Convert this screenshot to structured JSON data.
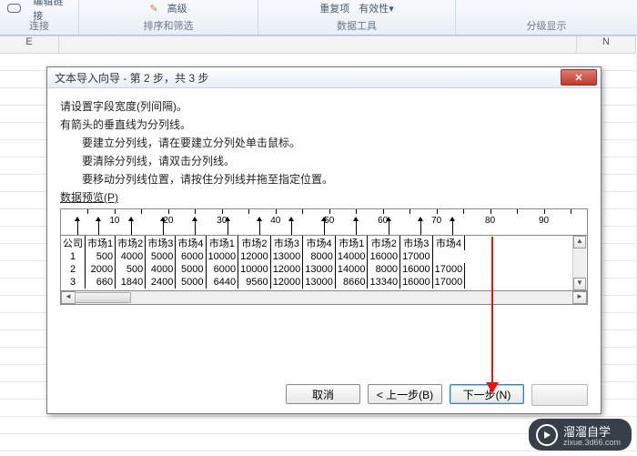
{
  "ribbon": {
    "links": {
      "edit": "编辑链接",
      "group": "连接"
    },
    "sort": {
      "adv": "高级",
      "group": "排序和筛选"
    },
    "data": {
      "redo": "重复项",
      "valid": "有效性▾",
      "group": "数据工具"
    },
    "outline": {
      "group": "分级显示"
    }
  },
  "col_e": "E",
  "col_n": "N",
  "dlg": {
    "title": "文本导入向导 - 第 2 步，共 3 步",
    "l1": "请设置字段宽度(列间隔)。",
    "l2": "有箭头的垂直线为分列线。",
    "l3": "要建立分列线，请在要建立分列处单击鼠标。",
    "l4": "要清除分列线，请双击分列线。",
    "l5": "要移动分列线位置，请按住分列线并拖至指定位置。",
    "preview": "数据预览(P)",
    "ticks": [
      "10",
      "20",
      "30",
      "40",
      "50",
      "60",
      "70",
      "80",
      "90"
    ],
    "headers": [
      "公司",
      "市场1",
      "市场2",
      "市场3",
      "市场4",
      "市场1",
      "市场2",
      "市场3",
      "市场4",
      "市场1",
      "市场2",
      "市场3",
      "市场4"
    ],
    "rows": [
      [
        "1",
        "500",
        "4000",
        "5000",
        "6000",
        "10000",
        "12000",
        "13000",
        "8000",
        "14000",
        "16000",
        "17000"
      ],
      [
        "2",
        "2000",
        "500",
        "4000",
        "5000",
        "6000",
        "10000",
        "12000",
        "13000",
        "14000",
        "8000",
        "16000",
        "17000"
      ],
      [
        "3",
        "660",
        "1840",
        "2400",
        "5000",
        "6440",
        "9560",
        "12000",
        "13000",
        "8660",
        "13340",
        "16000",
        "17000"
      ]
    ],
    "btn_cancel": "取消",
    "btn_back": "< 上一步(B)",
    "btn_next": "下一步(N)"
  },
  "wm": {
    "t": "溜溜自学",
    "s": "zixue.3d66.com"
  }
}
